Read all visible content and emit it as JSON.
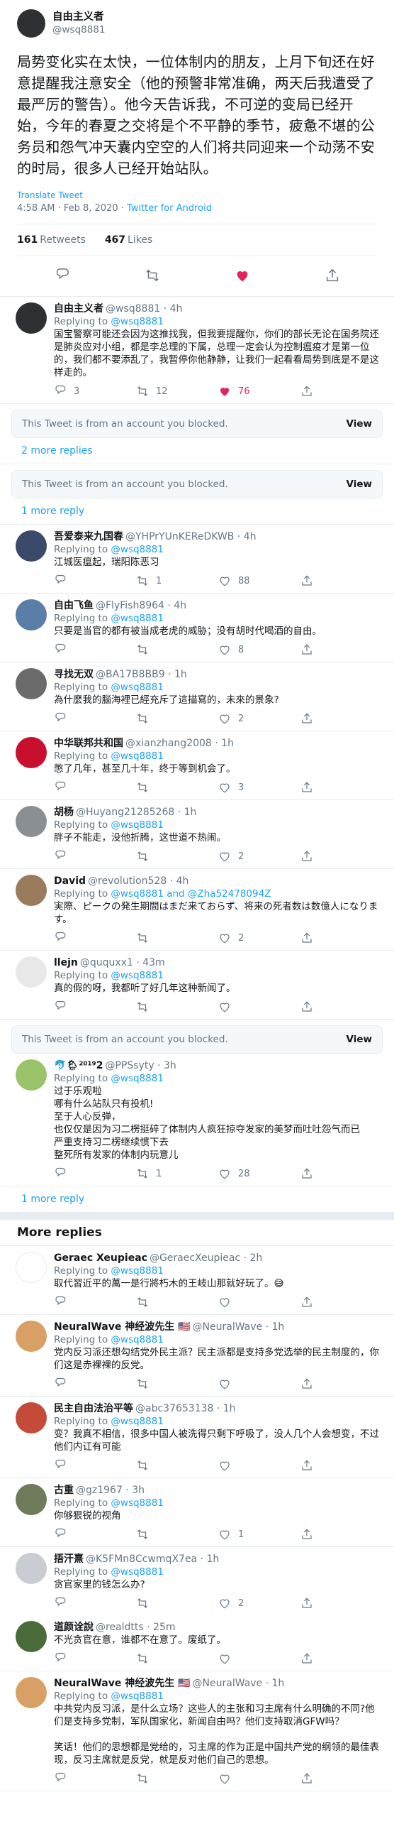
{
  "main": {
    "name": "自由主义者",
    "handle": "@wsq8881",
    "text": "局势变化实在太快，一位体制内的朋友，上月下旬还在好意提醒我注意安全（他的预警非常准确，两天后我遭受了最严厉的警告）。他今天告诉我，不可逆的变局已经开始，今年的春夏之交将是个不平静的季节，疲惫不堪的公务员和怨气冲天囊内空空的人们将共同迎来一个动荡不安的时局，很多人已经开始站队。",
    "translate": "Translate Tweet",
    "time": "4:58 AM · Feb 8, 2020 · ",
    "client": "Twitter for Android",
    "retweets": "161",
    "retweets_label": "Retweets",
    "likes": "467",
    "likes_label": "Likes",
    "colors": {
      "accent": "#1da1f2",
      "like": "#e0245e"
    }
  },
  "replies1": [
    {
      "name": "自由主义者",
      "handle": "@wsq8881 · 4h",
      "replying_prefix": "Replying to ",
      "replying": "@wsq8881",
      "text": "国宝警察可能还会因为这推找我，但我要提醒你，你们的部长无论在国务院还是肺炎应对小组，都是李总理的下属，总理一定会认为控制瘟疫才是第一位的，我们都不要添乱了，我暂停你他静静，让我们一起看看局势到底是不是这样走的。",
      "replies": "3",
      "retweets": "12",
      "likes": "76",
      "liked": true,
      "avatar": "#2f3033"
    }
  ],
  "blocked_text": "This Tweet is from an account you blocked.",
  "blocked_view": "View",
  "more1": "2 more replies",
  "more2": "1 more reply",
  "replies2": [
    {
      "name": "吾爱泰来九国春",
      "handle": "@YHPrYUnKEReDKWB · 4h",
      "replying_prefix": "Replying to ",
      "replying": "@wsq8881",
      "text": "江城医瘟起，瑞阳陈恶习",
      "replies": "",
      "retweets": "1",
      "likes": "88",
      "liked": false,
      "avatar": "#3b4a6b"
    },
    {
      "name": "自由飞鱼",
      "handle": "@FlyFish8964 · 4h",
      "replying_prefix": "Replying to ",
      "replying": "@wsq8881",
      "text": "只要是当官的都有被当成老虎的威胁；没有胡时代喝酒的自由。",
      "replies": "",
      "retweets": "",
      "likes": "8",
      "liked": false,
      "avatar": "#5a7ea8"
    },
    {
      "name": "寻找无双",
      "handle": "@BA17B8BB9 · 1h",
      "replying_prefix": "Replying to ",
      "replying": "@wsq8881",
      "text": "為什麼我的腦海裡已經充斥了這描寫的，未來的景象?",
      "replies": "",
      "retweets": "",
      "likes": "2",
      "liked": false,
      "avatar": "#6b6b6b"
    },
    {
      "name": "中华联邦共和国",
      "handle": "@xianzhang2008 · 1h",
      "replying_prefix": "Replying to ",
      "replying": "@wsq8881",
      "text": "憋了几年，甚至几十年，终于等到机会了。",
      "replies": "",
      "retweets": "",
      "likes": "3",
      "liked": false,
      "avatar": "#c8102e"
    },
    {
      "name": "胡杨",
      "handle": "@Huyang21285268 · 1h",
      "replying_prefix": "Replying to ",
      "replying": "@wsq8881",
      "text": "胖子不能走，没他折腾，这世道不热闹。",
      "replies": "",
      "retweets": "",
      "likes": "2",
      "liked": false,
      "avatar": "#8a8f94"
    },
    {
      "name": "David",
      "handle": "@revolution528 · 4h",
      "replying_prefix": "Replying to ",
      "replying": "@wsq8881 and @Zha52478094Z",
      "text": "実際、ピークの発生期間はまだ来ておらず、将来の死者数は数億人になります。",
      "replies": "",
      "retweets": "",
      "likes": "2",
      "liked": false,
      "avatar": "#9a7b5c"
    },
    {
      "name": "llejn",
      "handle": "@ququxx1 · 43m",
      "replying_prefix": "Replying to ",
      "replying": "@wsq8881",
      "text": "真的假的呀，我都听了好几年这种新闻了。",
      "replies": "",
      "retweets": "",
      "likes": "",
      "liked": false,
      "avatar": "#e8e8e8"
    }
  ],
  "reply_ppss": {
    "name": "🐬🌦²⁰¹⁹2",
    "handle": "@PPSsyty · 3h",
    "replying_prefix": "Replying to ",
    "replying": "@wsq8881",
    "text": "过于乐观啦\n哪有什么站队只有投机!\n至于人心反弹，\n也仅仅是因为习二楞挺碎了体制内人疯狂掠夺发家的美梦而吐吐怨气而已\n严重支持习二楞继续惯下去\n整死所有发家的体制内玩意儿",
    "replies": "",
    "retweets": "1",
    "likes": "28",
    "liked": false,
    "avatar": "#9ac46a"
  },
  "more_replies_title": "More replies",
  "replies3": [
    {
      "name": "Geraec Xeupieac",
      "handle": "@GeraecXeupieac · 2h",
      "replying_prefix": "Replying to ",
      "replying": "@wsq8881",
      "text": "取代習近平的萬一是行將朽木的王岐山那就好玩了。😅",
      "replies": "",
      "retweets": "",
      "likes": "",
      "liked": false,
      "avatar": "#ffffff",
      "line": true
    },
    {
      "name": "NeuralWave 神经波先生 🇺🇸",
      "handle": "@NeuralWave · 1h",
      "replying_prefix": "Replying to ",
      "replying": "@wsq8881",
      "text": "党内反习派还想勾结党外民主派？民主派都是支持多党选举的民主制度的，你们这是赤裸裸的反党。",
      "replies": "",
      "retweets": "",
      "likes": "",
      "liked": false,
      "avatar": "#d9a066"
    },
    {
      "name": "民主自由法治平等",
      "handle": "@abc37653138 · 1h",
      "replying_prefix": "Replying to ",
      "replying": "@wsq8881",
      "text": "变？我真不相信，很多中国人被洗得只剩下呼吸了，没人几个人会想变，不过他们内讧有可能",
      "replies": "",
      "retweets": "",
      "likes": "",
      "liked": false,
      "avatar": "#c44a3a"
    },
    {
      "name": "古重",
      "handle": "@gz1967 · 3h",
      "replying_prefix": "Replying to ",
      "replying": "@wsq8881",
      "text": "你够狠锐的视角",
      "replies": "",
      "retweets": "",
      "likes": "1",
      "liked": false,
      "avatar": "#6e7a5a"
    },
    {
      "name": "捂汗熹",
      "handle": "@K5FMn8CcwmqX7ea · 1h",
      "replying_prefix": "Replying to ",
      "replying": "@wsq8881",
      "text": "贪官家里的钱怎么办?",
      "replies": "",
      "retweets": "",
      "likes": "2",
      "liked": false,
      "avatar": "#c9ccd1",
      "line": true,
      "nob": true
    },
    {
      "name": "道颜诠說",
      "handle": "@realdtts · 25m",
      "replying_prefix": "",
      "replying": "",
      "text": "不光贪官在意，谁都不在意了。废纸了。",
      "replies": "",
      "retweets": "",
      "likes": "",
      "liked": false,
      "avatar": "#4a6b3a"
    },
    {
      "name": "NeuralWave 神经波先生 🇺🇸",
      "handle": "@NeuralWave · 1h",
      "replying_prefix": "Replying to ",
      "replying": "@wsq8881",
      "text": "中共党内反习派，是什么立场？这些人的主张和习主席有什么明确的不同?他们是支持多党制，军队国家化，新闻自由吗？他们支持取消GFW吗？\n\n笑话！他们的思想都是党给的，习主席的作为正是中国共产党的纲领的最佳表现，反习主席就是反党，就是反对他们自己的思想。",
      "replies": "",
      "retweets": "",
      "likes": "",
      "liked": false,
      "avatar": "#d9a066"
    }
  ]
}
